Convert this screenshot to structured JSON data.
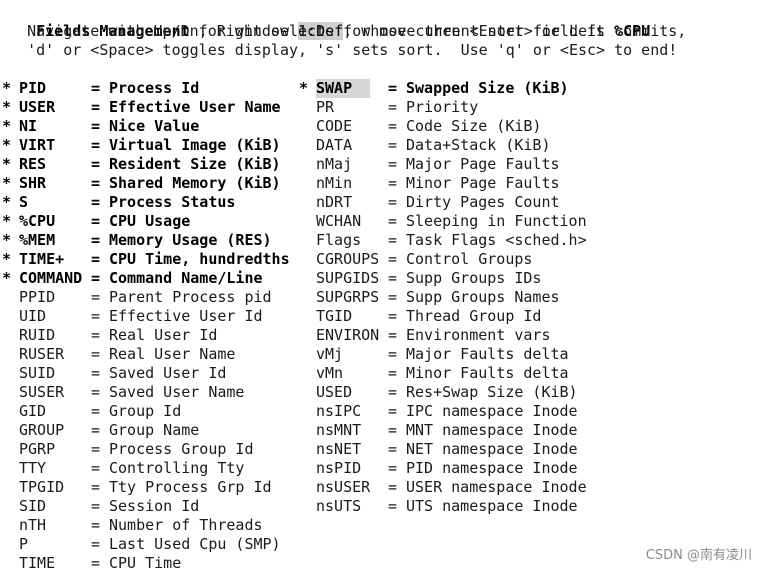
{
  "header": {
    "title_prefix": "Fields Management",
    "window_text": " for window ",
    "window_id": "1:Def",
    "sort_text": ", whose current sort field is ",
    "sort_field": "%CPU",
    "help_line_1": "   Navigate with Up/Dn, Right selects for move then <Enter> or Left commits,",
    "help_line_2": "   'd' or <Space> toggles display, 's' sets sort.  Use 'q' or <Esc> to end!"
  },
  "left_fields": [
    {
      "mark": "*",
      "name": "PID",
      "desc": "Process Id"
    },
    {
      "mark": "*",
      "name": "USER",
      "desc": "Effective User Name"
    },
    {
      "mark": "*",
      "name": "NI",
      "desc": "Nice Value"
    },
    {
      "mark": "*",
      "name": "VIRT",
      "desc": "Virtual Image (KiB)"
    },
    {
      "mark": "*",
      "name": "RES",
      "desc": "Resident Size (KiB)"
    },
    {
      "mark": "*",
      "name": "SHR",
      "desc": "Shared Memory (KiB)"
    },
    {
      "mark": "*",
      "name": "S",
      "desc": "Process Status"
    },
    {
      "mark": "*",
      "name": "%CPU",
      "desc": "CPU Usage"
    },
    {
      "mark": "*",
      "name": "%MEM",
      "desc": "Memory Usage (RES)"
    },
    {
      "mark": "*",
      "name": "TIME+",
      "desc": "CPU Time, hundredths"
    },
    {
      "mark": "*",
      "name": "COMMAND",
      "desc": "Command Name/Line"
    },
    {
      "mark": "",
      "name": "PPID",
      "desc": "Parent Process pid"
    },
    {
      "mark": "",
      "name": "UID",
      "desc": "Effective User Id"
    },
    {
      "mark": "",
      "name": "RUID",
      "desc": "Real User Id"
    },
    {
      "mark": "",
      "name": "RUSER",
      "desc": "Real User Name"
    },
    {
      "mark": "",
      "name": "SUID",
      "desc": "Saved User Id"
    },
    {
      "mark": "",
      "name": "SUSER",
      "desc": "Saved User Name"
    },
    {
      "mark": "",
      "name": "GID",
      "desc": "Group Id"
    },
    {
      "mark": "",
      "name": "GROUP",
      "desc": "Group Name"
    },
    {
      "mark": "",
      "name": "PGRP",
      "desc": "Process Group Id"
    },
    {
      "mark": "",
      "name": "TTY",
      "desc": "Controlling Tty"
    },
    {
      "mark": "",
      "name": "TPGID",
      "desc": "Tty Process Grp Id"
    },
    {
      "mark": "",
      "name": "SID",
      "desc": "Session Id"
    },
    {
      "mark": "",
      "name": "nTH",
      "desc": "Number of Threads"
    },
    {
      "mark": "",
      "name": "P",
      "desc": "Last Used Cpu (SMP)"
    },
    {
      "mark": "",
      "name": "TIME",
      "desc": "CPU Time"
    }
  ],
  "right_fields": [
    {
      "mark": "*",
      "name": "SWAP",
      "desc": "Swapped Size (KiB)"
    },
    {
      "mark": "",
      "name": "PR",
      "desc": "Priority"
    },
    {
      "mark": "",
      "name": "CODE",
      "desc": "Code Size (KiB)"
    },
    {
      "mark": "",
      "name": "DATA",
      "desc": "Data+Stack (KiB)"
    },
    {
      "mark": "",
      "name": "nMaj",
      "desc": "Major Page Faults"
    },
    {
      "mark": "",
      "name": "nMin",
      "desc": "Minor Page Faults"
    },
    {
      "mark": "",
      "name": "nDRT",
      "desc": "Dirty Pages Count"
    },
    {
      "mark": "",
      "name": "WCHAN",
      "desc": "Sleeping in Function"
    },
    {
      "mark": "",
      "name": "Flags",
      "desc": "Task Flags <sched.h>"
    },
    {
      "mark": "",
      "name": "CGROUPS",
      "desc": "Control Groups"
    },
    {
      "mark": "",
      "name": "SUPGIDS",
      "desc": "Supp Groups IDs"
    },
    {
      "mark": "",
      "name": "SUPGRPS",
      "desc": "Supp Groups Names"
    },
    {
      "mark": "",
      "name": "TGID",
      "desc": "Thread Group Id"
    },
    {
      "mark": "",
      "name": "ENVIRON",
      "desc": "Environment vars"
    },
    {
      "mark": "",
      "name": "vMj",
      "desc": "Major Faults delta"
    },
    {
      "mark": "",
      "name": "vMn",
      "desc": "Minor Faults delta"
    },
    {
      "mark": "",
      "name": "USED",
      "desc": "Res+Swap Size (KiB)"
    },
    {
      "mark": "",
      "name": "nsIPC",
      "desc": "IPC namespace Inode"
    },
    {
      "mark": "",
      "name": "nsMNT",
      "desc": "MNT namespace Inode"
    },
    {
      "mark": "",
      "name": "nsNET",
      "desc": "NET namespace Inode"
    },
    {
      "mark": "",
      "name": "nsPID",
      "desc": "PID namespace Inode"
    },
    {
      "mark": "",
      "name": "nsUSER",
      "desc": "USER namespace Inode"
    },
    {
      "mark": "",
      "name": "nsUTS",
      "desc": "UTS namespace Inode"
    }
  ],
  "equals": "=",
  "selected_field": "SWAP",
  "watermark": "CSDN @南有凌川"
}
